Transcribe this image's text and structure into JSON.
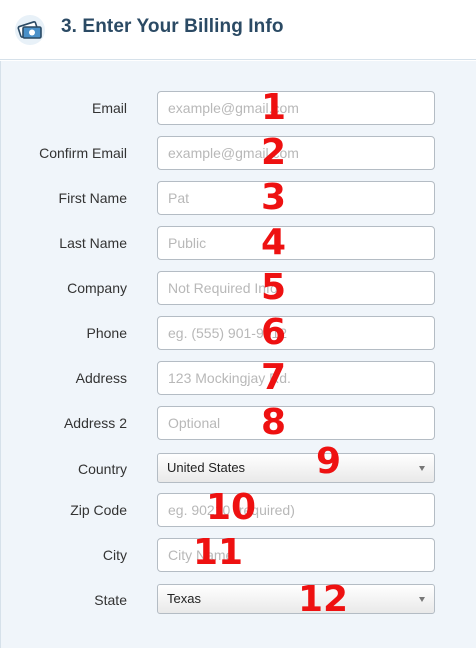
{
  "header": {
    "title": "3. Enter Your Billing Info",
    "icon": "money-icon"
  },
  "form": {
    "email": {
      "label": "Email",
      "placeholder": "example@gmail.com"
    },
    "confirm_email": {
      "label": "Confirm Email",
      "placeholder": "example@gmail.com"
    },
    "first_name": {
      "label": "First Name",
      "placeholder": "Pat"
    },
    "last_name": {
      "label": "Last Name",
      "placeholder": "Public"
    },
    "company": {
      "label": "Company",
      "placeholder": "Not Required Info"
    },
    "phone": {
      "label": "Phone",
      "placeholder": "eg. (555) 901-9012"
    },
    "address": {
      "label": "Address",
      "placeholder": "123 Mockingjay Rd."
    },
    "address2": {
      "label": "Address 2",
      "placeholder": "Optional"
    },
    "country": {
      "label": "Country",
      "selected": "United States"
    },
    "zip": {
      "label": "Zip Code",
      "placeholder": "eg. 90210 (required)"
    },
    "city": {
      "label": "City",
      "placeholder": "City Name"
    },
    "state": {
      "label": "State",
      "selected": "Texas"
    }
  },
  "annotations": [
    "1",
    "2",
    "3",
    "4",
    "5",
    "6",
    "7",
    "8",
    "9",
    "10",
    "11",
    "12"
  ],
  "colors": {
    "title": "#2b4a64",
    "panel": "#f0f5fa",
    "annotation": "#ee1111"
  }
}
